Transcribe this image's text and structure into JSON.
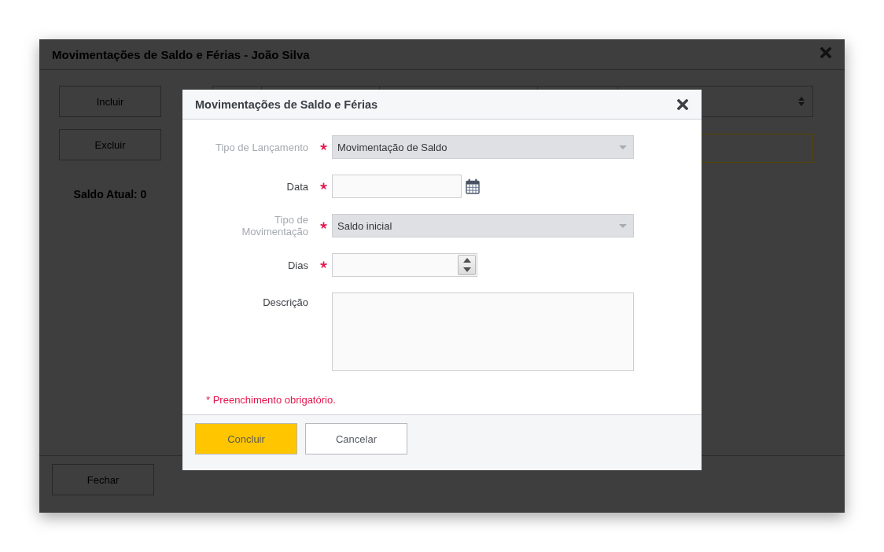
{
  "window": {
    "title": "Movimentações de Saldo e Férias - João Silva"
  },
  "toolbar": {
    "buttons": [
      "Incluir",
      "Excluir"
    ]
  },
  "balance": "Saldo Atual: 0",
  "dialog": {
    "title": "Movimentações de Saldo e Férias",
    "fields": [
      {
        "kind": "select",
        "label": "Tipo de Lançamento",
        "required": true,
        "disabled": true,
        "value": "Movimentação de Saldo"
      },
      {
        "kind": "date",
        "label": "Data",
        "required": true,
        "disabled": false
      },
      {
        "kind": "select",
        "label": "Tipo de Movimentação",
        "required": true,
        "disabled": true,
        "value": "Saldo inicial"
      },
      {
        "kind": "number",
        "label": "Dias",
        "required": true,
        "disabled": false
      },
      {
        "kind": "textarea",
        "label": "Descrição",
        "required": false,
        "disabled": false
      }
    ],
    "required_note": "* Preenchimento obrigatório.",
    "buttons": [
      {
        "label": "Concluir",
        "kind": "primary"
      },
      {
        "label": "Cancelar",
        "kind": "secondary"
      }
    ]
  },
  "footer": {
    "buttons": [
      "Fechar"
    ]
  }
}
